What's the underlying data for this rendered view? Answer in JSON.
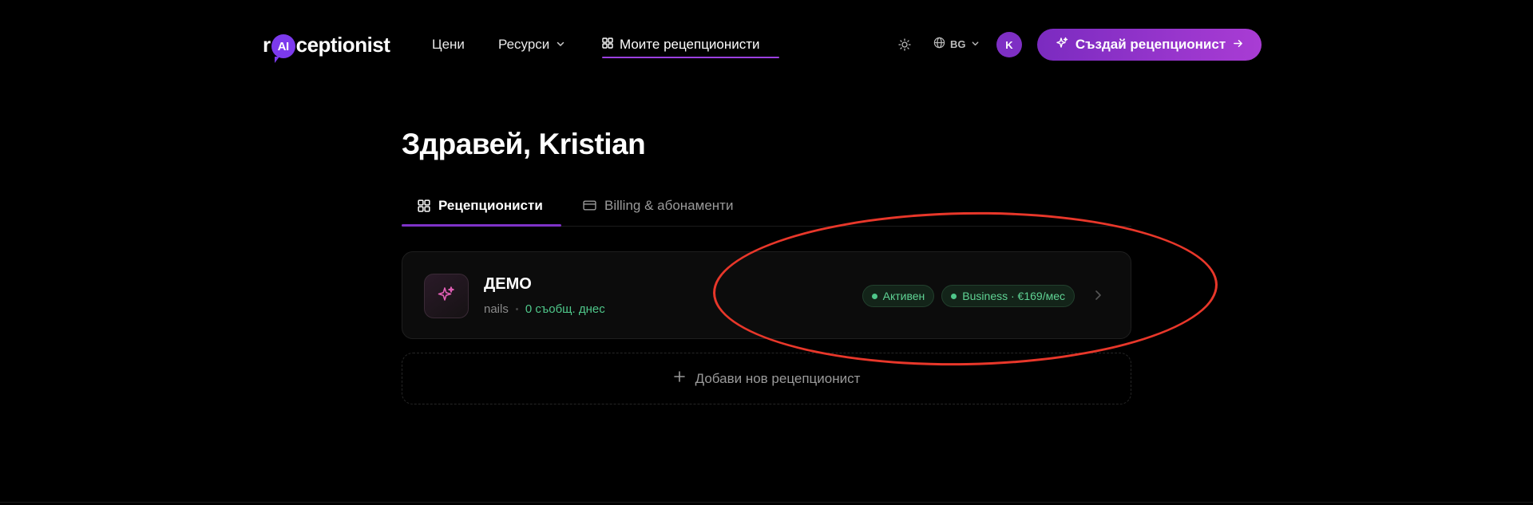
{
  "nav": {
    "logo_prefix": "r",
    "logo_badge": "AI",
    "logo_suffix": "ceptionist",
    "links": [
      {
        "label": "Цени"
      },
      {
        "label": "Ресурси"
      },
      {
        "label": "Моите рецепционисти"
      }
    ],
    "language": "BG",
    "avatar_initial": "K",
    "cta_label": "Създай рецепционист"
  },
  "main": {
    "greeting": "Здравей, Kristian",
    "tabs": [
      {
        "label": "Рецепционисти",
        "active": true
      },
      {
        "label": "Billing & абонаменти",
        "active": false
      }
    ],
    "receptionists": [
      {
        "name": "ДЕМО",
        "type": "nails",
        "messages_today": "0 съобщ. днес",
        "badges": [
          "Активен",
          "Business · €169/мес"
        ]
      }
    ],
    "add_label": "Добави нов рецепционист"
  },
  "colors": {
    "accent": "#7e32c8",
    "success": "#4fc78a",
    "annotation": "#e8372a"
  }
}
